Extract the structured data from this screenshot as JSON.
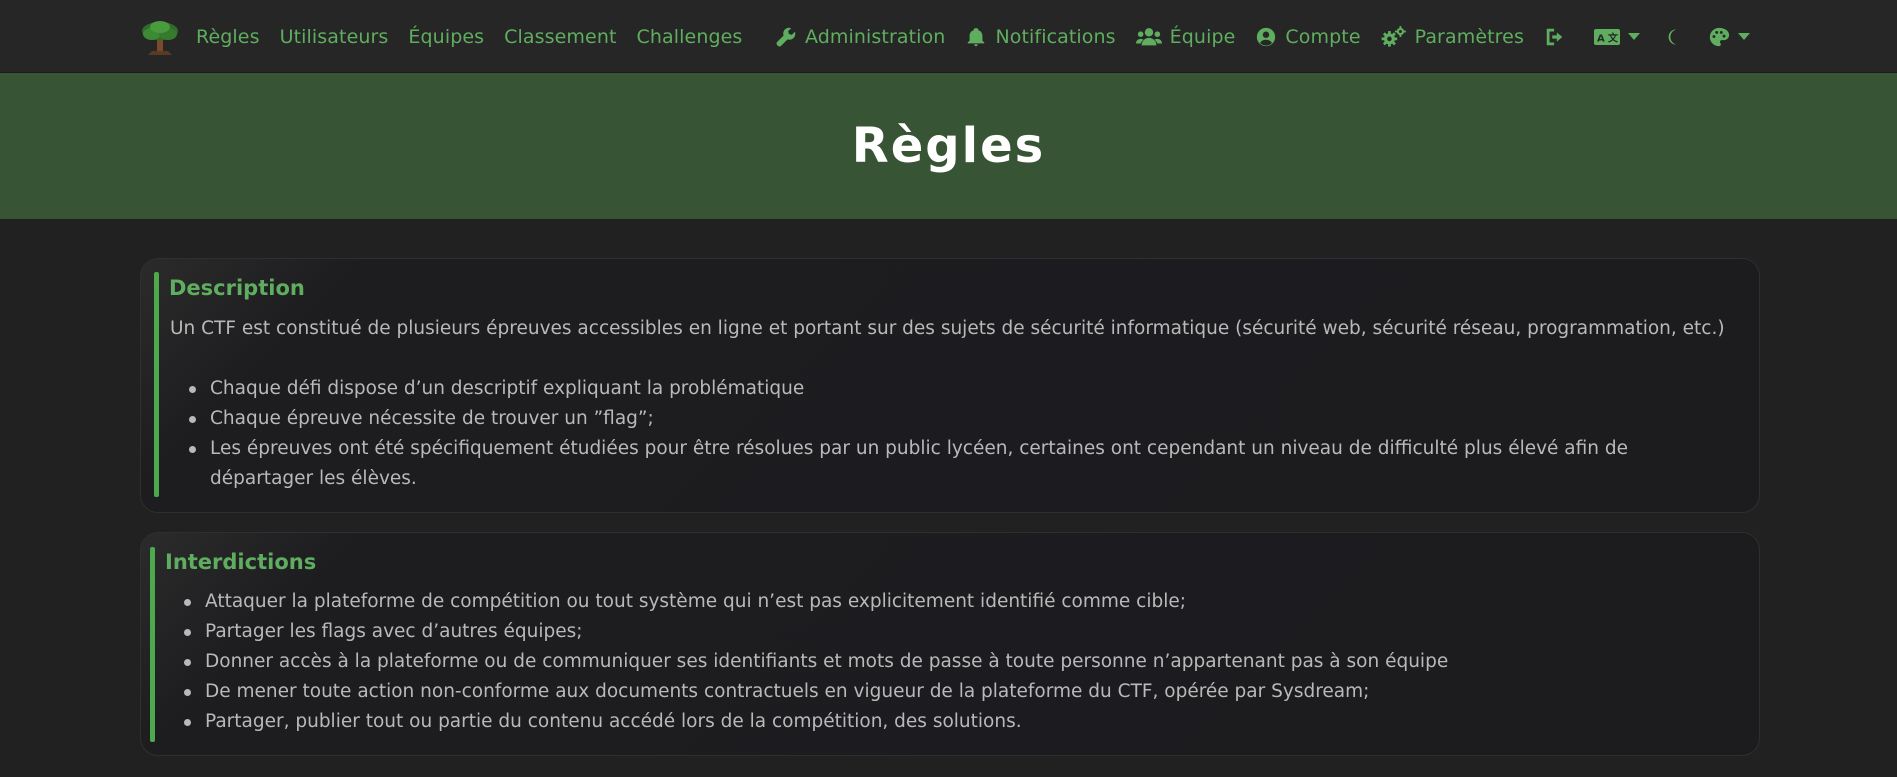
{
  "nav": {
    "links": [
      "Règles",
      "Utilisateurs",
      "Équipes",
      "Classement",
      "Challenges"
    ],
    "admin": "Administration",
    "notifications": "Notifications",
    "team": "Équipe",
    "account": "Compte",
    "settings": "Paramètres",
    "icons": [
      "logo-tree-icon",
      "wrench-icon",
      "bell-icon",
      "users-icon",
      "user-circle-icon",
      "cogs-icon",
      "logout-icon",
      "language-icon",
      "moon-icon",
      "palette-icon"
    ],
    "accent_color": "#5fae5f"
  },
  "hero": {
    "title": "Règles",
    "bg_color": "#375534"
  },
  "description": {
    "title": "Description",
    "intro": "Un CTF est constitué de plusieurs épreuves accessibles en ligne et portant sur des sujets de sécurité informatique (sécurité web, sécurité réseau, programmation, etc.)",
    "items": [
      "Chaque défi dispose d’un descriptif expliquant la problématique",
      "Chaque épreuve nécessite de trouver un ”flag”;",
      "Les épreuves ont été spécifiquement étudiées pour être résolues par un public lycéen, certaines ont cependant un niveau de difficulté plus élevé afin de départager les élèves."
    ]
  },
  "interdictions": {
    "title": "Interdictions",
    "items": [
      "Attaquer la plateforme de compétition ou tout système qui n’est pas explicitement identifié comme cible;",
      "Partager les flags avec d’autres équipes;",
      "Donner accès à la plateforme ou de communiquer ses identifiants et mots de passe à toute personne n’appartenant pas à son équipe",
      "De mener toute action non-conforme aux documents contractuels en vigueur de la plateforme du CTF, opérée par Sysdream;",
      "Partager, publier tout ou partie du contenu accédé lors de la compétition, des solutions."
    ]
  }
}
